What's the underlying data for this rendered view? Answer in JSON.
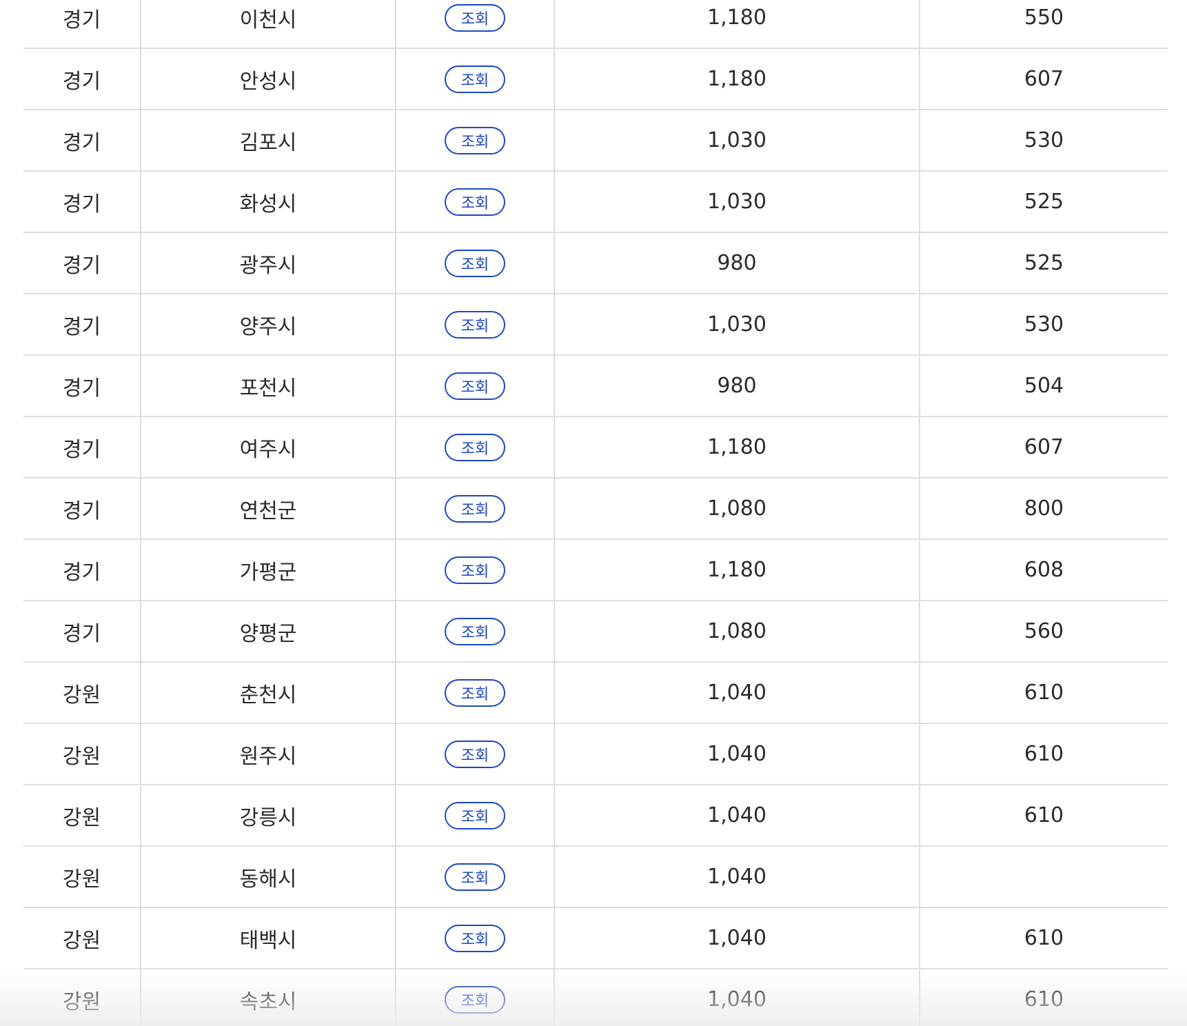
{
  "button_label": "조회",
  "rows": [
    {
      "region": "경기",
      "city": "이천시",
      "value1": "1,180",
      "value2": "550"
    },
    {
      "region": "경기",
      "city": "안성시",
      "value1": "1,180",
      "value2": "607"
    },
    {
      "region": "경기",
      "city": "김포시",
      "value1": "1,030",
      "value2": "530"
    },
    {
      "region": "경기",
      "city": "화성시",
      "value1": "1,030",
      "value2": "525"
    },
    {
      "region": "경기",
      "city": "광주시",
      "value1": "980",
      "value2": "525"
    },
    {
      "region": "경기",
      "city": "양주시",
      "value1": "1,030",
      "value2": "530"
    },
    {
      "region": "경기",
      "city": "포천시",
      "value1": "980",
      "value2": "504"
    },
    {
      "region": "경기",
      "city": "여주시",
      "value1": "1,180",
      "value2": "607"
    },
    {
      "region": "경기",
      "city": "연천군",
      "value1": "1,080",
      "value2": "800"
    },
    {
      "region": "경기",
      "city": "가평군",
      "value1": "1,180",
      "value2": "608"
    },
    {
      "region": "경기",
      "city": "양평군",
      "value1": "1,080",
      "value2": "560"
    },
    {
      "region": "강원",
      "city": "춘천시",
      "value1": "1,040",
      "value2": "610"
    },
    {
      "region": "강원",
      "city": "원주시",
      "value1": "1,040",
      "value2": "610"
    },
    {
      "region": "강원",
      "city": "강릉시",
      "value1": "1,040",
      "value2": "610"
    },
    {
      "region": "강원",
      "city": "동해시",
      "value1": "1,040",
      "value2": ""
    },
    {
      "region": "강원",
      "city": "태백시",
      "value1": "1,040",
      "value2": "610"
    },
    {
      "region": "강원",
      "city": "속초시",
      "value1": "1,040",
      "value2": "610"
    }
  ]
}
